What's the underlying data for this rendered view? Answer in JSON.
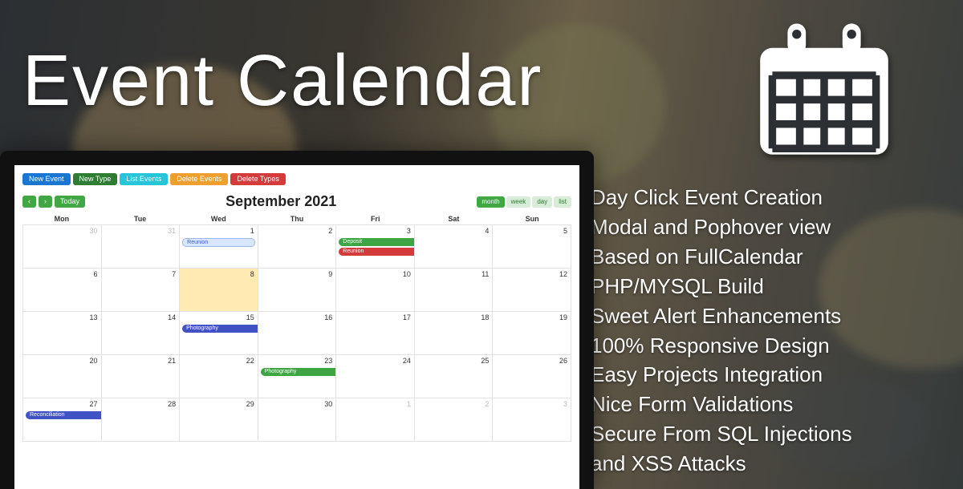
{
  "hero": {
    "title": "Event Calendar"
  },
  "features": [
    "Day Click Event Creation",
    "Modal and Pophover view",
    "Based on FullCalendar",
    "PHP/MYSQL Build",
    "Sweet Alert Enhancements",
    "100% Responsive Design",
    "Easy Projects Integration",
    "Nice Form Validations",
    "Secure From SQL Injections",
    "and XSS Attacks"
  ],
  "app": {
    "toolbar": {
      "new_event": "New Event",
      "new_type": "New Type",
      "list_events": "List Events",
      "delete_events": "Delete Events",
      "delete_types": "Delete Types"
    },
    "nav": {
      "prev": "‹",
      "next": "›",
      "today": "Today"
    },
    "title": "September 2021",
    "views": {
      "month": "month",
      "week": "week",
      "day": "day",
      "list": "list"
    },
    "dow": [
      "Mon",
      "Tue",
      "Wed",
      "Thu",
      "Fri",
      "Sat",
      "Sun"
    ],
    "cells": [
      {
        "n": "30",
        "muted": true
      },
      {
        "n": "31",
        "muted": true
      },
      {
        "n": "1",
        "pills": [
          {
            "t": "Reunion",
            "c": "p-blue"
          }
        ]
      },
      {
        "n": "2"
      },
      {
        "n": "3",
        "pills": [
          {
            "t": "Deposit",
            "c": "p-green",
            "span": 2
          },
          {
            "t": "Reunion",
            "c": "p-red",
            "span": 2
          }
        ]
      },
      {
        "n": "4"
      },
      {
        "n": "5"
      },
      {
        "n": "6"
      },
      {
        "n": "7"
      },
      {
        "n": "8",
        "today": true
      },
      {
        "n": "9"
      },
      {
        "n": "10"
      },
      {
        "n": "11"
      },
      {
        "n": "12"
      },
      {
        "n": "13"
      },
      {
        "n": "14"
      },
      {
        "n": "15",
        "pills": [
          {
            "t": "Photography",
            "c": "p-indigo",
            "span": 2
          }
        ]
      },
      {
        "n": "16"
      },
      {
        "n": "17"
      },
      {
        "n": "18"
      },
      {
        "n": "19"
      },
      {
        "n": "20"
      },
      {
        "n": "21"
      },
      {
        "n": "22"
      },
      {
        "n": "23",
        "pills": [
          {
            "t": "Photography",
            "c": "p-green",
            "span": 3
          }
        ]
      },
      {
        "n": "24"
      },
      {
        "n": "25"
      },
      {
        "n": "26"
      },
      {
        "n": "27",
        "pills": [
          {
            "t": "Reconciliation",
            "c": "p-indigo",
            "span": 2
          }
        ]
      },
      {
        "n": "28"
      },
      {
        "n": "29"
      },
      {
        "n": "30"
      },
      {
        "n": "1",
        "muted": true
      },
      {
        "n": "2",
        "muted": true
      },
      {
        "n": "3",
        "muted": true
      }
    ]
  }
}
